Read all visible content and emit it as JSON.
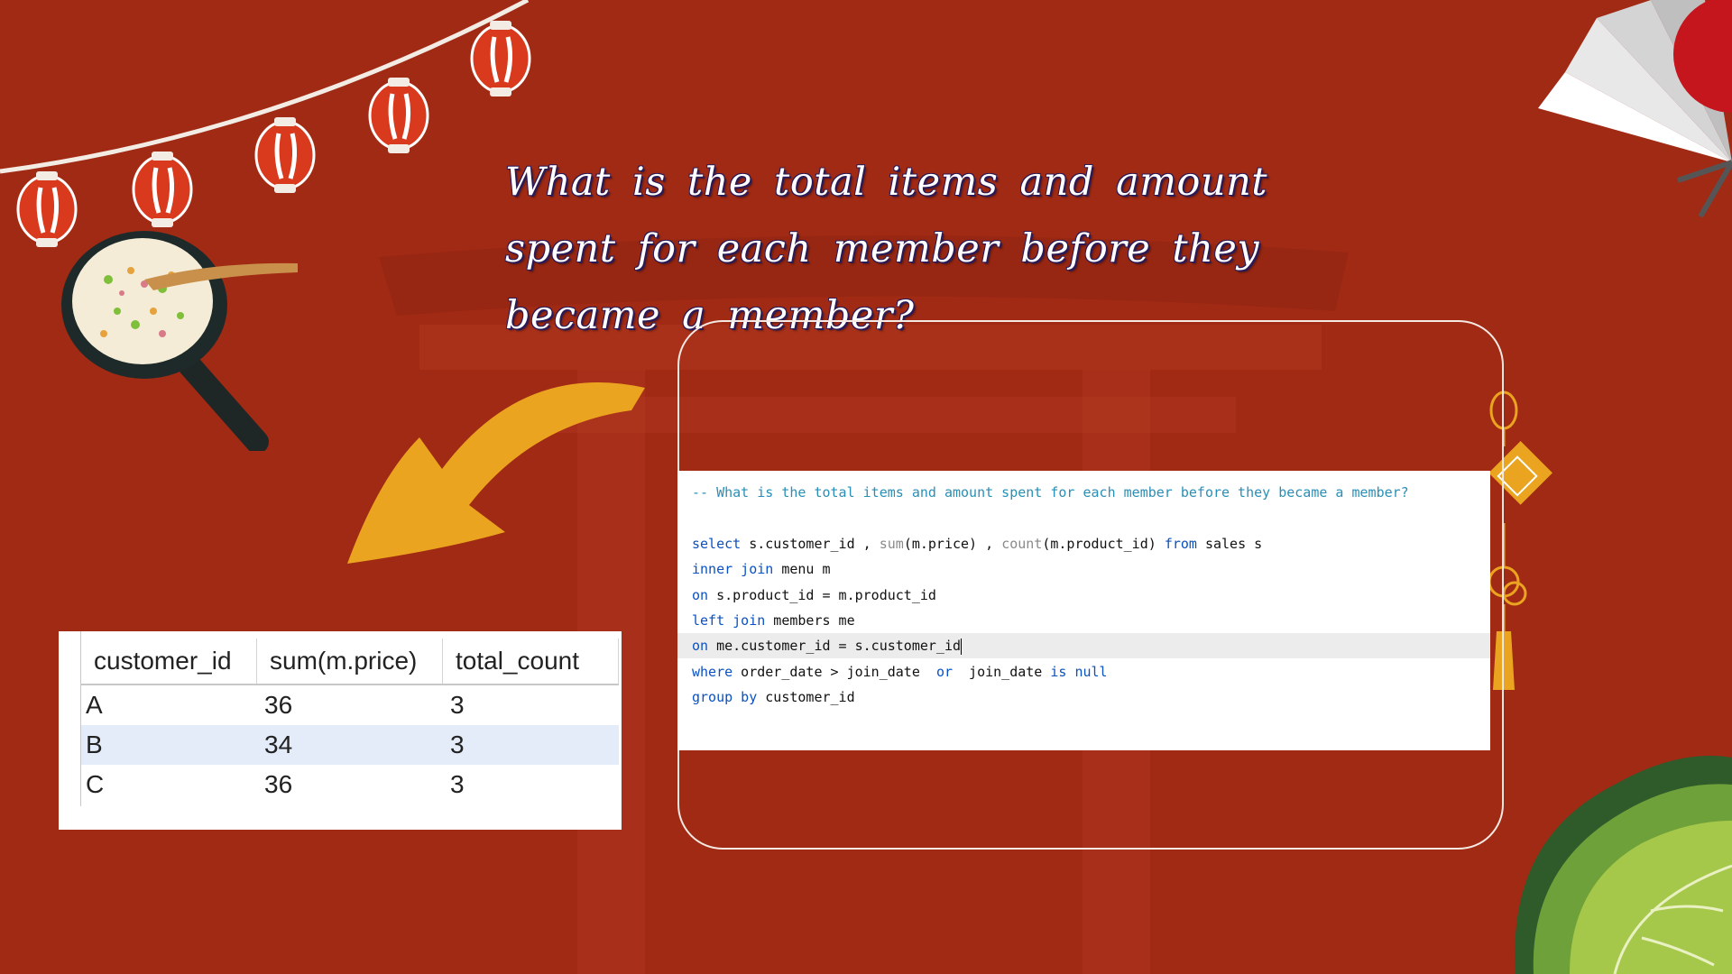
{
  "slide": {
    "title": "What is the total items and amount spent for each member before they became a member?",
    "colors": {
      "background": "#a12a14",
      "title_outline": "#2b1a55",
      "arrow": "#eba41f",
      "keyword": "#0a51c2",
      "comment": "#2a8fb6"
    }
  },
  "code": {
    "comment": "-- What is the total items and amount spent for each member before they became a member?",
    "line1": {
      "kw1": "select",
      "t1": " s.customer_id , ",
      "fn1": "sum",
      "t2": "(m.price) , ",
      "fn2": "count",
      "t3": "(m.product_id) ",
      "kw2": "from",
      "t4": " sales s"
    },
    "line2": {
      "kw1": "inner join",
      "t1": " menu m"
    },
    "line3": {
      "kw1": "on",
      "t1": " s.product_id = m.product_id"
    },
    "line4": {
      "kw1": "left join",
      "t1": " members me"
    },
    "line5": {
      "kw1": "on",
      "t1": " me.customer_id = s.customer_id"
    },
    "line6": {
      "kw1": "where",
      "t1": " order_date > join_date  ",
      "kw2": "or",
      "t2": "  join_date ",
      "kw3": "is null"
    },
    "line7": {
      "kw1": "group by",
      "t1": " customer_id"
    }
  },
  "result": {
    "columns": [
      "customer_id",
      "sum(m.price)",
      "total_count"
    ],
    "rows": [
      [
        "A",
        "36",
        "3"
      ],
      [
        "B",
        "34",
        "3"
      ],
      [
        "C",
        "36",
        "3"
      ]
    ],
    "selected_row": 1
  },
  "icons": [
    "lantern-garland-icon",
    "fried-rice-pan-icon",
    "curved-arrow-icon",
    "paper-fan-icon",
    "chinese-knot-ornament-icon",
    "cabbage-icon",
    "torii-gate-silhouette"
  ]
}
